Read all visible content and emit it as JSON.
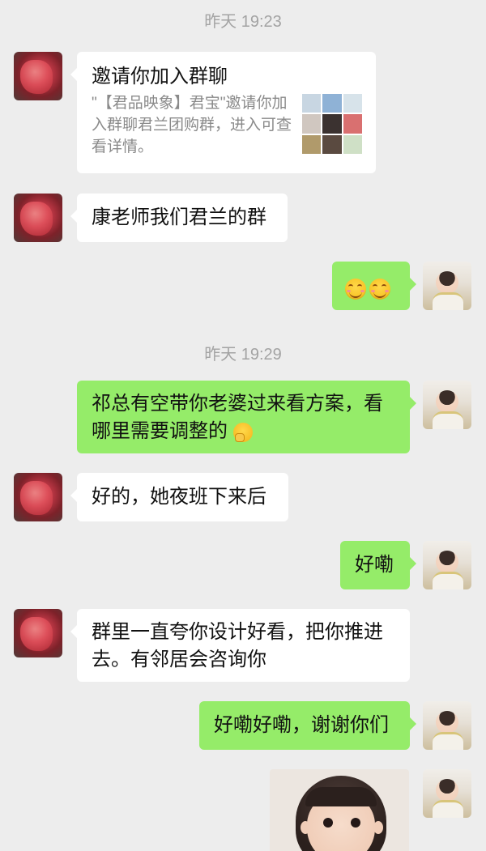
{
  "timestamps": [
    "昨天 19:23",
    "昨天 19:29"
  ],
  "invite_card": {
    "title": "邀请你加入群聊",
    "description": "\"【君品映象】君宝\"邀请你加入群聊君兰团购群，进入可查看详情。",
    "thumb_colors": [
      "#c8d6e2",
      "#8fb2d6",
      "#d7e3ea",
      "#d0c7c0",
      "#3b3230",
      "#d97070",
      "#b09a6b",
      "#5a4a40",
      "#cfe0c6"
    ]
  },
  "messages": {
    "m1": "康老师我们君兰的群",
    "m3": "祁总有空带你老婆过来看方案，看哪里需要调整的",
    "m4": "好的，她夜班下来后",
    "m5": "好嘞",
    "m6": "群里一直夸你设计好看，把你推进去。有邻居会咨询你",
    "m7": "好嘞好嘞，谢谢你们"
  },
  "icons": {
    "smile_emoji": "smiling-face-emoji",
    "think_emoji": "thinking-face-emoji"
  },
  "colors": {
    "background": "#ededed",
    "bubble_self": "#95ec69",
    "bubble_other": "#ffffff"
  }
}
